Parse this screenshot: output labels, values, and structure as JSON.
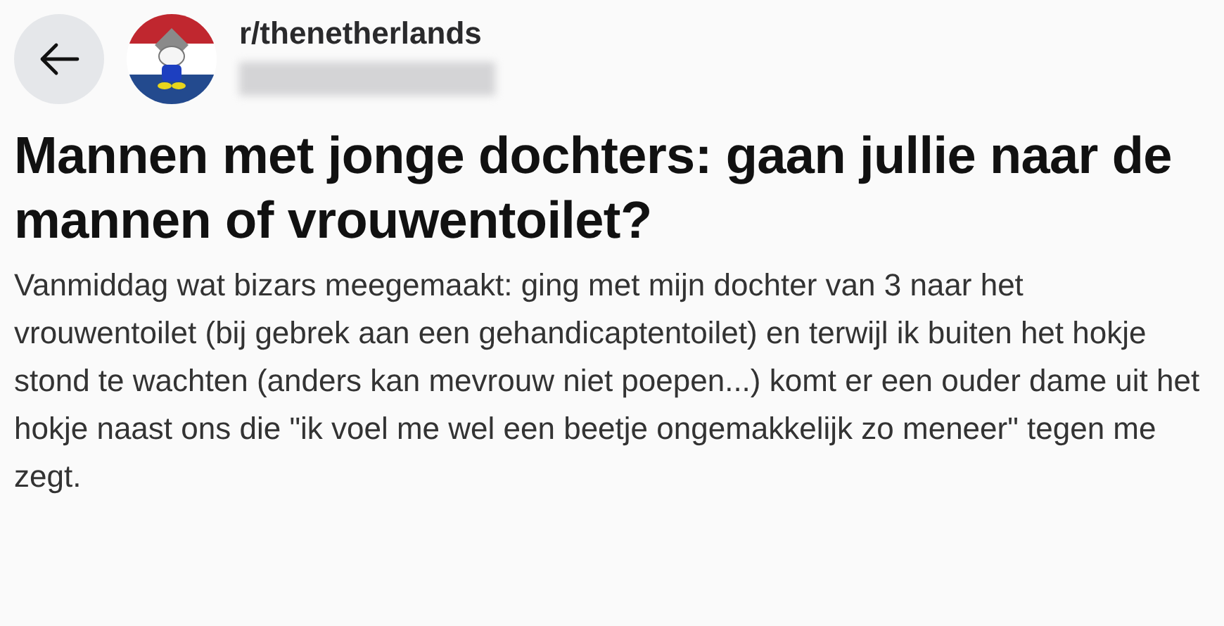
{
  "header": {
    "subreddit": "r/thenetherlands"
  },
  "post": {
    "title": "Mannen met jonge dochters: gaan jullie naar de mannen of vrouwentoilet?",
    "body": "Vanmiddag wat bizars meegemaakt: ging met mijn dochter van 3 naar het vrouwentoilet (bij gebrek aan een gehandicaptentoilet) en terwijl ik buiten het hokje stond te wachten (anders kan mevrouw niet poepen...) komt er een ouder dame uit het hokje naast ons die \"ik voel me wel een beetje ongemakkelijk zo meneer\" tegen me zegt."
  }
}
